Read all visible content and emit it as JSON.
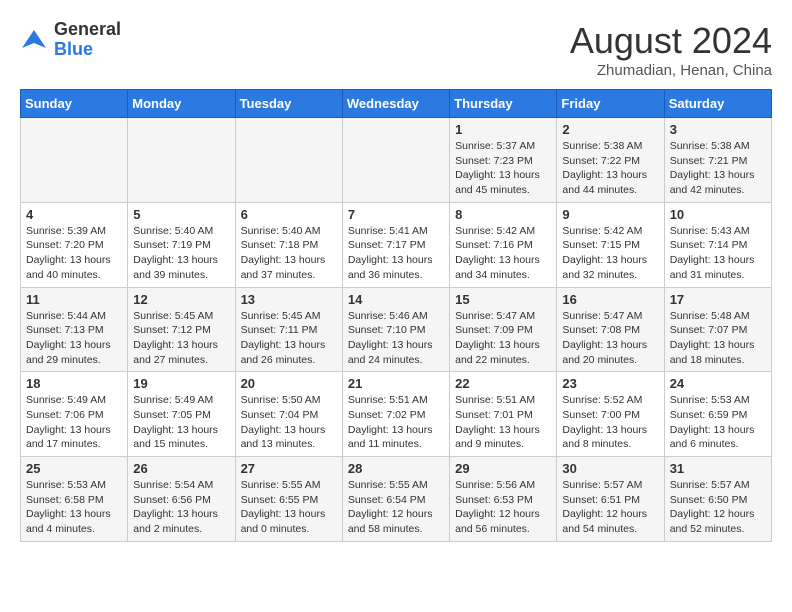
{
  "header": {
    "logo_general": "General",
    "logo_blue": "Blue",
    "month_title": "August 2024",
    "location": "Zhumadian, Henan, China"
  },
  "weekdays": [
    "Sunday",
    "Monday",
    "Tuesday",
    "Wednesday",
    "Thursday",
    "Friday",
    "Saturday"
  ],
  "weeks": [
    [
      {
        "day": "",
        "info": ""
      },
      {
        "day": "",
        "info": ""
      },
      {
        "day": "",
        "info": ""
      },
      {
        "day": "",
        "info": ""
      },
      {
        "day": "1",
        "info": "Sunrise: 5:37 AM\nSunset: 7:23 PM\nDaylight: 13 hours\nand 45 minutes."
      },
      {
        "day": "2",
        "info": "Sunrise: 5:38 AM\nSunset: 7:22 PM\nDaylight: 13 hours\nand 44 minutes."
      },
      {
        "day": "3",
        "info": "Sunrise: 5:38 AM\nSunset: 7:21 PM\nDaylight: 13 hours\nand 42 minutes."
      }
    ],
    [
      {
        "day": "4",
        "info": "Sunrise: 5:39 AM\nSunset: 7:20 PM\nDaylight: 13 hours\nand 40 minutes."
      },
      {
        "day": "5",
        "info": "Sunrise: 5:40 AM\nSunset: 7:19 PM\nDaylight: 13 hours\nand 39 minutes."
      },
      {
        "day": "6",
        "info": "Sunrise: 5:40 AM\nSunset: 7:18 PM\nDaylight: 13 hours\nand 37 minutes."
      },
      {
        "day": "7",
        "info": "Sunrise: 5:41 AM\nSunset: 7:17 PM\nDaylight: 13 hours\nand 36 minutes."
      },
      {
        "day": "8",
        "info": "Sunrise: 5:42 AM\nSunset: 7:16 PM\nDaylight: 13 hours\nand 34 minutes."
      },
      {
        "day": "9",
        "info": "Sunrise: 5:42 AM\nSunset: 7:15 PM\nDaylight: 13 hours\nand 32 minutes."
      },
      {
        "day": "10",
        "info": "Sunrise: 5:43 AM\nSunset: 7:14 PM\nDaylight: 13 hours\nand 31 minutes."
      }
    ],
    [
      {
        "day": "11",
        "info": "Sunrise: 5:44 AM\nSunset: 7:13 PM\nDaylight: 13 hours\nand 29 minutes."
      },
      {
        "day": "12",
        "info": "Sunrise: 5:45 AM\nSunset: 7:12 PM\nDaylight: 13 hours\nand 27 minutes."
      },
      {
        "day": "13",
        "info": "Sunrise: 5:45 AM\nSunset: 7:11 PM\nDaylight: 13 hours\nand 26 minutes."
      },
      {
        "day": "14",
        "info": "Sunrise: 5:46 AM\nSunset: 7:10 PM\nDaylight: 13 hours\nand 24 minutes."
      },
      {
        "day": "15",
        "info": "Sunrise: 5:47 AM\nSunset: 7:09 PM\nDaylight: 13 hours\nand 22 minutes."
      },
      {
        "day": "16",
        "info": "Sunrise: 5:47 AM\nSunset: 7:08 PM\nDaylight: 13 hours\nand 20 minutes."
      },
      {
        "day": "17",
        "info": "Sunrise: 5:48 AM\nSunset: 7:07 PM\nDaylight: 13 hours\nand 18 minutes."
      }
    ],
    [
      {
        "day": "18",
        "info": "Sunrise: 5:49 AM\nSunset: 7:06 PM\nDaylight: 13 hours\nand 17 minutes."
      },
      {
        "day": "19",
        "info": "Sunrise: 5:49 AM\nSunset: 7:05 PM\nDaylight: 13 hours\nand 15 minutes."
      },
      {
        "day": "20",
        "info": "Sunrise: 5:50 AM\nSunset: 7:04 PM\nDaylight: 13 hours\nand 13 minutes."
      },
      {
        "day": "21",
        "info": "Sunrise: 5:51 AM\nSunset: 7:02 PM\nDaylight: 13 hours\nand 11 minutes."
      },
      {
        "day": "22",
        "info": "Sunrise: 5:51 AM\nSunset: 7:01 PM\nDaylight: 13 hours\nand 9 minutes."
      },
      {
        "day": "23",
        "info": "Sunrise: 5:52 AM\nSunset: 7:00 PM\nDaylight: 13 hours\nand 8 minutes."
      },
      {
        "day": "24",
        "info": "Sunrise: 5:53 AM\nSunset: 6:59 PM\nDaylight: 13 hours\nand 6 minutes."
      }
    ],
    [
      {
        "day": "25",
        "info": "Sunrise: 5:53 AM\nSunset: 6:58 PM\nDaylight: 13 hours\nand 4 minutes."
      },
      {
        "day": "26",
        "info": "Sunrise: 5:54 AM\nSunset: 6:56 PM\nDaylight: 13 hours\nand 2 minutes."
      },
      {
        "day": "27",
        "info": "Sunrise: 5:55 AM\nSunset: 6:55 PM\nDaylight: 13 hours\nand 0 minutes."
      },
      {
        "day": "28",
        "info": "Sunrise: 5:55 AM\nSunset: 6:54 PM\nDaylight: 12 hours\nand 58 minutes."
      },
      {
        "day": "29",
        "info": "Sunrise: 5:56 AM\nSunset: 6:53 PM\nDaylight: 12 hours\nand 56 minutes."
      },
      {
        "day": "30",
        "info": "Sunrise: 5:57 AM\nSunset: 6:51 PM\nDaylight: 12 hours\nand 54 minutes."
      },
      {
        "day": "31",
        "info": "Sunrise: 5:57 AM\nSunset: 6:50 PM\nDaylight: 12 hours\nand 52 minutes."
      }
    ]
  ]
}
